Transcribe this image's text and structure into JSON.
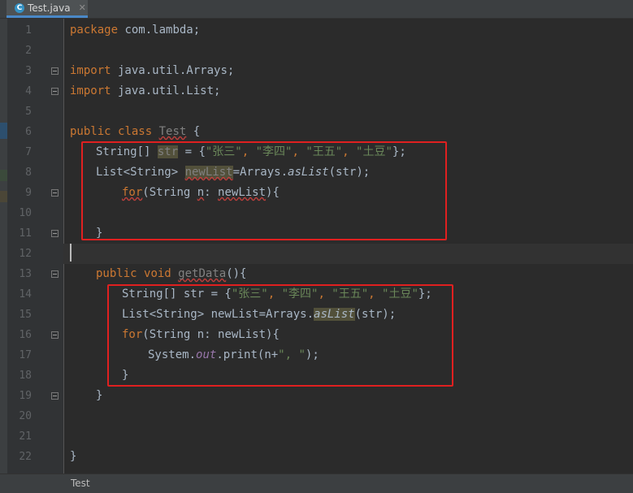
{
  "tab": {
    "icon": "java-class-icon",
    "icon_letter": "C",
    "name": "Test.java",
    "close": "✕"
  },
  "line_numbers": [
    "1",
    "2",
    "3",
    "4",
    "5",
    "6",
    "7",
    "8",
    "9",
    "10",
    "11",
    "12",
    "13",
    "14",
    "15",
    "16",
    "17",
    "18",
    "19",
    "20",
    "21",
    "22"
  ],
  "code": {
    "l1_kw": "package",
    "l1_rest": " com.lambda;",
    "l3_kw": "import",
    "l3_rest": " java.util.Arrays;",
    "l4_kw": "import",
    "l4_rest": " java.util.List;",
    "l6_kw1": "public",
    "l6_kw2": "class",
    "l6_name": "Test",
    "l6_rest": " {",
    "l7_a": "String[] ",
    "l7_var": "str",
    "l7_b": " = {",
    "l7_s1": "\"张三\"",
    "l7_c1": ", ",
    "l7_s2": "\"李四\"",
    "l7_c2": ", ",
    "l7_s3": "\"王五\"",
    "l7_c3": ", ",
    "l7_s4": "\"土豆\"",
    "l7_end": "};",
    "l8_a": "List<String> ",
    "l8_var": "newList",
    "l8_b": "=Arrays.",
    "l8_m": "asList",
    "l8_c": "(str);",
    "l9_kw": "for",
    "l9_a": "(String ",
    "l9_n": "n",
    "l9_b": ": ",
    "l9_var": "newList",
    "l9_c": "){",
    "l11": "}",
    "l13_kw1": "public",
    "l13_kw2": "void",
    "l13_fn": "getData",
    "l13_rest": "(){",
    "l14_a": "String[] str = {",
    "l14_s1": "\"张三\"",
    "l14_c1": ", ",
    "l14_s2": "\"李四\"",
    "l14_c2": ", ",
    "l14_s3": "\"王五\"",
    "l14_c3": ", ",
    "l14_s4": "\"土豆\"",
    "l14_end": "};",
    "l15_a": "List<String> newList=Arrays.",
    "l15_m": "asList",
    "l15_b": "(str);",
    "l16_kw": "for",
    "l16_a": "(String n: newList){",
    "l17_a": "System.",
    "l17_f": "out",
    "l17_b": ".print(n+",
    "l17_s": "\", \"",
    "l17_c": ");",
    "l18": "}",
    "l19": "}",
    "l22": "}"
  },
  "status": {
    "text": "Test"
  },
  "colors": {
    "keyword": "#cc7832",
    "string": "#6a8759",
    "static_field": "#9876aa",
    "method_decl": "#ffc66d",
    "highlight_box": "#e02020",
    "background": "#2b2b2b"
  }
}
